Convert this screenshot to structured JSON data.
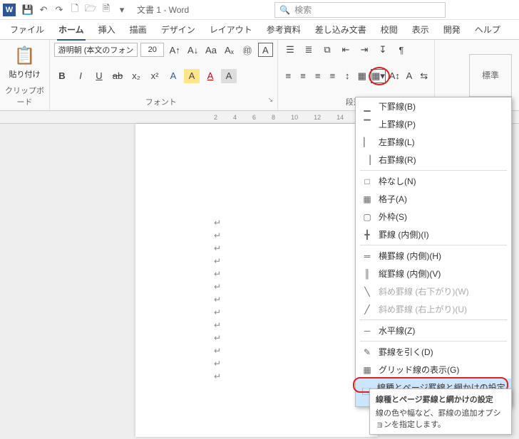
{
  "titlebar": {
    "appinitial": "W",
    "doctitle": "文書 1  -  Word",
    "search_placeholder": "検索"
  },
  "tabs": [
    "ファイル",
    "ホーム",
    "挿入",
    "描画",
    "デザイン",
    "レイアウト",
    "参考資料",
    "差し込み文書",
    "校閲",
    "表示",
    "開発",
    "ヘルプ"
  ],
  "active_tab": 1,
  "clipboard": {
    "paste": "貼り付け",
    "group": "クリップボード"
  },
  "font": {
    "name": "游明朝 (本文のフォン",
    "size": "20",
    "group": "フォント",
    "bold": "B",
    "italic": "I",
    "underline": "U",
    "strike": "ab",
    "sub": "x₂",
    "sup": "x²",
    "A_effects": "A",
    "A_highlight": "A",
    "A_color": "A",
    "A_box": "A",
    "A_phonetic": "Aa",
    "caseglyph": "A"
  },
  "paragraph": {
    "group": "段落"
  },
  "style_default": "標準",
  "ruler_ticks": [
    2,
    4,
    6,
    8,
    10,
    12,
    14
  ],
  "borders_menu": [
    {
      "label": "下罫線(B)",
      "shortcut": "B",
      "icon": "bottom"
    },
    {
      "label": "上罫線(P)",
      "shortcut": "P",
      "icon": "top"
    },
    {
      "label": "左罫線(L)",
      "shortcut": "L",
      "icon": "left"
    },
    {
      "label": "右罫線(R)",
      "shortcut": "R",
      "icon": "right"
    },
    "sep",
    {
      "label": "枠なし(N)",
      "shortcut": "N",
      "icon": "none"
    },
    {
      "label": "格子(A)",
      "shortcut": "A",
      "icon": "all"
    },
    {
      "label": "外枠(S)",
      "shortcut": "S",
      "icon": "box"
    },
    {
      "label": "罫線 (内側)(I)",
      "shortcut": "I",
      "icon": "inside"
    },
    "sep",
    {
      "label": "横罫線 (内側)(H)",
      "shortcut": "H",
      "icon": "h"
    },
    {
      "label": "縦罫線 (内側)(V)",
      "shortcut": "V",
      "icon": "v"
    },
    {
      "label": "斜め罫線 (右下がり)(W)",
      "shortcut": "W",
      "icon": "ddown",
      "disabled": true
    },
    {
      "label": "斜め罫線 (右上がり)(U)",
      "shortcut": "U",
      "icon": "dup",
      "disabled": true
    },
    "sep",
    {
      "label": "水平線(Z)",
      "shortcut": "Z",
      "icon": "hr"
    },
    "sep",
    {
      "label": "罫線を引く(D)",
      "shortcut": "D",
      "icon": "draw"
    },
    {
      "label": "グリッド線の表示(G)",
      "shortcut": "G",
      "icon": "grid"
    },
    {
      "label": "線種とページ罫線と網かけの設定(O)...",
      "shortcut": "O",
      "icon": "settings",
      "highlight": true
    }
  ],
  "tooltip": {
    "title": "線種とページ罫線と網かけの設定",
    "text": "線の色や幅など、罫線の追加オプションを指定します。"
  }
}
